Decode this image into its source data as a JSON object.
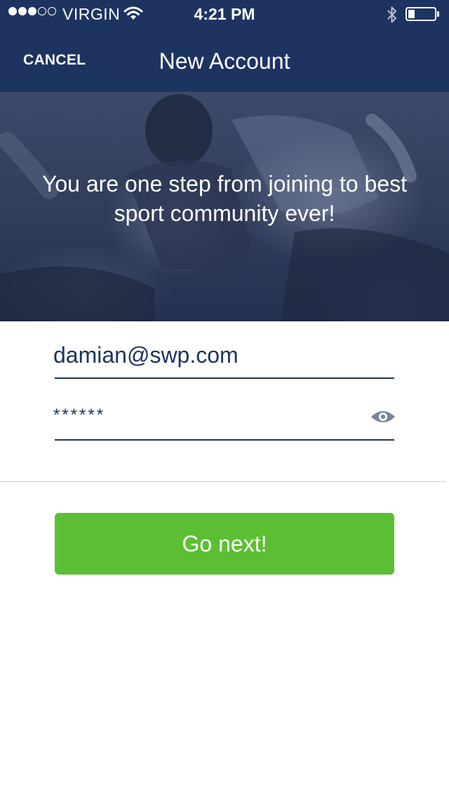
{
  "status_bar": {
    "carrier": "VIRGIN",
    "time": "4:21 PM",
    "signal_strength": 3,
    "signal_max": 5,
    "battery_level": 0.25
  },
  "nav": {
    "cancel_label": "CANCEL",
    "title": "New Account"
  },
  "hero": {
    "message": "You are one step from joining to best sport community ever!"
  },
  "form": {
    "email_value": "damian@swp.com",
    "password_value": "******",
    "reveal_icon": "eye-icon"
  },
  "actions": {
    "next_label": "Go next!"
  },
  "colors": {
    "nav_background": "#1d3461",
    "primary_button": "#5cbf33",
    "input_text": "#1d3461",
    "icon_gray": "#7a8599"
  }
}
